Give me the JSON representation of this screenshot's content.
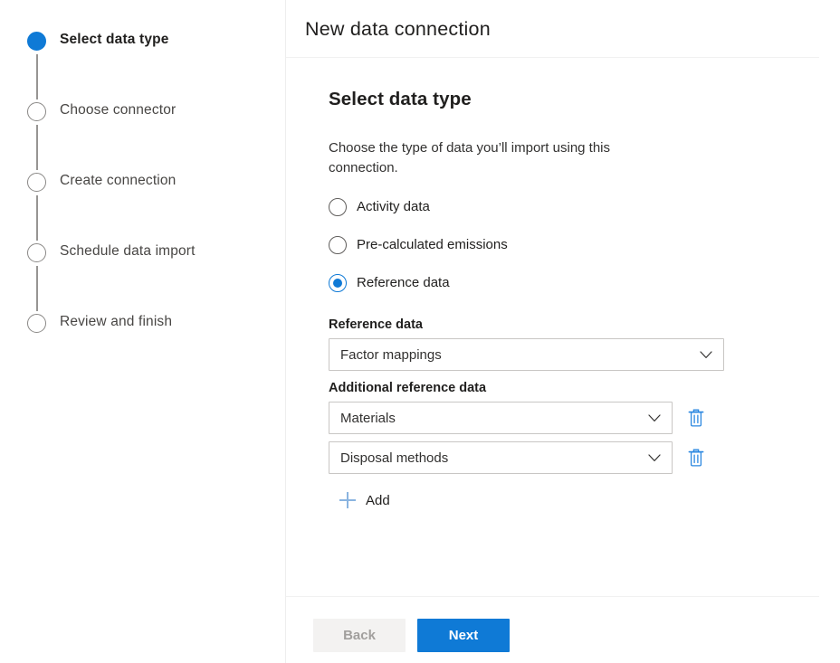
{
  "wizard": {
    "steps": [
      {
        "label": "Select data type",
        "state": "active"
      },
      {
        "label": "Choose connector",
        "state": "pending"
      },
      {
        "label": "Create connection",
        "state": "pending"
      },
      {
        "label": "Schedule data import",
        "state": "pending"
      },
      {
        "label": "Review and finish",
        "state": "pending"
      }
    ]
  },
  "panel": {
    "title": "New data connection",
    "section_title": "Select data type",
    "description": "Choose the type of data you’ll import using this connection."
  },
  "data_type": {
    "options": [
      {
        "label": "Activity data",
        "selected": false
      },
      {
        "label": "Pre-calculated emissions",
        "selected": false
      },
      {
        "label": "Reference data",
        "selected": true
      }
    ]
  },
  "reference_data": {
    "label": "Reference data",
    "value": "Factor mappings",
    "additional_label": "Additional reference data",
    "additional": [
      {
        "value": "Materials"
      },
      {
        "value": "Disposal methods"
      }
    ],
    "add_label": "Add"
  },
  "footer": {
    "back_label": "Back",
    "next_label": "Next"
  },
  "colors": {
    "accent": "#0f7ad6",
    "accent_light": "#8ab4e0",
    "border": "#c8c6c4",
    "divider": "#f1f1f1",
    "text": "#201f1e",
    "muted": "#605e5c",
    "disabled_text": "#a19f9d",
    "disabled_bg": "#f3f2f1"
  }
}
